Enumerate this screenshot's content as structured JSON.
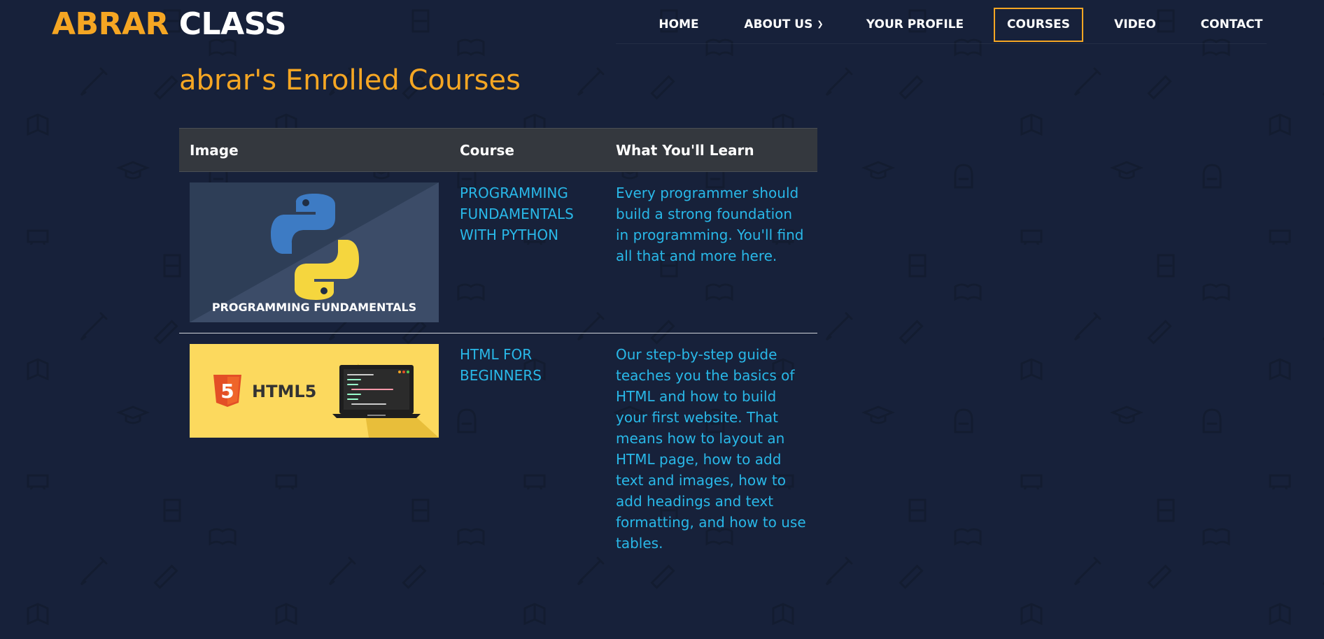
{
  "logo": {
    "part1": "ABRAR",
    "part2": "CLASS"
  },
  "nav": {
    "home": "HOME",
    "about": "ABOUT US",
    "profile": "YOUR PROFILE",
    "courses": "COURSES",
    "video": "VIDEO",
    "contact": "CONTACT",
    "active": "COURSES"
  },
  "page": {
    "title": "abrar's Enrolled Courses"
  },
  "table": {
    "headers": {
      "image": "Image",
      "course": "Course",
      "learn": "What You'll Learn"
    },
    "rows": [
      {
        "course": "PROGRAMMING FUNDAMENTALS WITH PYTHON",
        "learn": "Every programmer should build a strong foundation in programming. You'll find all that and more here.",
        "image_caption": "PROGRAMMING FUNDAMENTALS"
      },
      {
        "course": "HTML FOR BEGINNERS",
        "learn": "Our step-by-step guide teaches you the basics of HTML and how to build your first website. That means how to layout an HTML page, how to add text and images, how to add headings and text formatting, and how to use tables.",
        "image_caption": "HTML5"
      }
    ]
  },
  "colors": {
    "background": "#17213a",
    "accent": "#f5a623",
    "link": "#29b8e8",
    "table_header": "#34383e"
  }
}
